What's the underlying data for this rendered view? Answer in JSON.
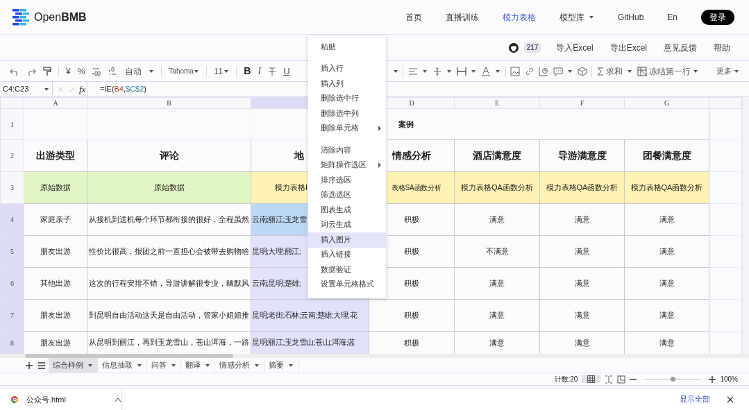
{
  "brand": {
    "name_light": "Open",
    "name_bold": "BMB"
  },
  "nav": {
    "items": [
      {
        "label": "首页",
        "selected": false,
        "dropdown": false
      },
      {
        "label": "直播训练",
        "selected": false,
        "dropdown": false
      },
      {
        "label": "模力表格",
        "selected": true,
        "dropdown": false
      },
      {
        "label": "模型库",
        "selected": false,
        "dropdown": true
      },
      {
        "label": "GitHub",
        "selected": false,
        "dropdown": false
      }
    ],
    "language": "En",
    "login": "登录"
  },
  "subbar": {
    "stars": "217",
    "actions": [
      "导入Excel",
      "导出Excel",
      "意见反馈",
      "帮助"
    ]
  },
  "toolbar": {
    "currency": "¥",
    "percent": "%",
    "format": "自动",
    "font": "Tahoma",
    "size": "11",
    "bold": "B",
    "italic": "I",
    "underline": "U",
    "sum": "求和",
    "freeze": "冻结第一行",
    "more": "更多"
  },
  "formula_bar": {
    "range": "C4:C23",
    "fx": "fx",
    "parts": [
      {
        "text": "=IE("
      },
      {
        "text": "B4",
        "color": "#b5442a"
      },
      {
        "text": ","
      },
      {
        "text": "$C$2",
        "color": "#2a8a8a"
      },
      {
        "text": ")"
      }
    ]
  },
  "sheet": {
    "columns": [
      {
        "label": "A",
        "selected": false
      },
      {
        "label": "B",
        "selected": false
      },
      {
        "selected": true
      },
      {
        "label": "D",
        "selected": false
      },
      {
        "label": "E",
        "selected": false
      },
      {
        "label": "F",
        "selected": false
      },
      {
        "label": "G",
        "selected": false
      }
    ],
    "title": "案例",
    "rows": [
      {
        "number": "1",
        "kind": "title",
        "selected": false,
        "cells": []
      },
      {
        "number": "2",
        "kind": "header",
        "selected": false,
        "cells": [
          {
            "text": "出游类型"
          },
          {
            "text": "评论"
          },
          {
            "text": "地"
          },
          {
            "text": "情感分析"
          },
          {
            "text": "酒店满意度"
          },
          {
            "text": "导游满意度"
          },
          {
            "text": "团餐满意度"
          }
        ]
      },
      {
        "number": "3",
        "kind": "label",
        "selected": false,
        "cells": [
          {
            "text": "原始数据",
            "color": "#e2f5c4"
          },
          {
            "text": "原始数据",
            "color": "#e2f5c4"
          },
          {
            "text": "模力表格I",
            "color": "#fff2b3"
          },
          {
            "text": "表格SA函数分析",
            "color": "#fff2b3"
          },
          {
            "text": "模力表格QA函数分析",
            "color": "#fff2b3"
          },
          {
            "text": "模力表格QA函数分析",
            "color": "#fff2b3"
          },
          {
            "text": "模力表格QA函数分析",
            "color": "#fff2b3"
          }
        ]
      },
      {
        "number": "4",
        "kind": "data",
        "selected": true,
        "cells": [
          {
            "text": "家庭亲子"
          },
          {
            "text": "从接机到送机每个环节都衔接的很好，全程虽然"
          },
          {
            "text": "云南;丽江;玉龙雪",
            "active": true
          },
          {
            "text": "积极"
          },
          {
            "text": "满意"
          },
          {
            "text": "满意"
          },
          {
            "text": "满意"
          }
        ]
      },
      {
        "number": "5",
        "kind": "data",
        "selected": true,
        "cells": [
          {
            "text": "朋友出游"
          },
          {
            "text": "性价比很高，报团之前一直担心会被带去购物啥"
          },
          {
            "text": "昆明;大理;丽江;",
            "active": false
          },
          {
            "text": "积极"
          },
          {
            "text": "不满意"
          },
          {
            "text": "满意"
          },
          {
            "text": "满意"
          }
        ]
      },
      {
        "number": "6",
        "kind": "data",
        "selected": true,
        "cells": [
          {
            "text": "其他出游"
          },
          {
            "text": "这次的行程安排不错，导游讲解很专业，幽默风"
          },
          {
            "text": "云南;昆明;楚雄;",
            "active": false
          },
          {
            "text": "积极"
          },
          {
            "text": "满意"
          },
          {
            "text": "满意"
          },
          {
            "text": "满意"
          }
        ]
      },
      {
        "number": "7",
        "kind": "data",
        "selected": true,
        "cells": [
          {
            "text": "朋友出游"
          },
          {
            "text": "到昆明自由活动这天是自由活动，管家小姐姐推"
          },
          {
            "text": "昆明;老街;石林;云南;楚雄;大理;花",
            "active": false
          },
          {
            "text": "积极"
          },
          {
            "text": "满意"
          },
          {
            "text": "满意"
          },
          {
            "text": "满意"
          }
        ]
      },
      {
        "number": "8",
        "kind": "data",
        "selected": true,
        "cells": [
          {
            "text": "朋友出游"
          },
          {
            "text": "从昆明到丽江，再到玉龙雪山，苍山洱海，一路"
          },
          {
            "text": "昆明;丽江;玉龙雪山;苍山;洱海;蓝",
            "active": false
          },
          {
            "text": "积极"
          },
          {
            "text": "满意"
          },
          {
            "text": "满意"
          },
          {
            "text": "满意"
          }
        ]
      }
    ]
  },
  "context_menu": [
    {
      "kind": "item",
      "label": "粘贴",
      "selected": false
    },
    {
      "kind": "separator"
    },
    {
      "kind": "item",
      "label": "插入行",
      "selected": false
    },
    {
      "kind": "item",
      "label": "插入列",
      "selected": false
    },
    {
      "kind": "item",
      "label": "删除选中行",
      "selected": false
    },
    {
      "kind": "item",
      "label": "删除选中列",
      "selected": false
    },
    {
      "kind": "submenu",
      "label": "删除单元格",
      "selected": false
    },
    {
      "kind": "separator"
    },
    {
      "kind": "item",
      "label": "清除内容",
      "selected": false
    },
    {
      "kind": "submenu",
      "label": "矩阵操作选区",
      "selected": false
    },
    {
      "kind": "item",
      "label": "排序选区",
      "selected": false
    },
    {
      "kind": "item",
      "label": "筛选选区",
      "selected": false
    },
    {
      "kind": "item",
      "label": "图表生成",
      "selected": false
    },
    {
      "kind": "item",
      "label": "词云生成",
      "selected": false
    },
    {
      "kind": "item",
      "label": "插入图片",
      "selected": true
    },
    {
      "kind": "item",
      "label": "插入链接",
      "selected": false
    },
    {
      "kind": "item",
      "label": "数据验证",
      "selected": false
    },
    {
      "kind": "item",
      "label": "设置单元格格式",
      "selected": false
    }
  ],
  "sheet_tabs": [
    {
      "label": "综合样例",
      "selected": true
    },
    {
      "label": "信息抽取",
      "selected": false
    },
    {
      "label": "问答",
      "selected": false
    },
    {
      "label": "翻译",
      "selected": false
    },
    {
      "label": "情感分析",
      "selected": false
    },
    {
      "label": "摘要",
      "selected": false
    }
  ],
  "status_bar": {
    "count": "计数:20",
    "zoom": {
      "level": 0.5
    },
    "zoom_reading": "100%"
  },
  "download_bar": {
    "file": "公众号.html",
    "show_all": "显示全部"
  }
}
